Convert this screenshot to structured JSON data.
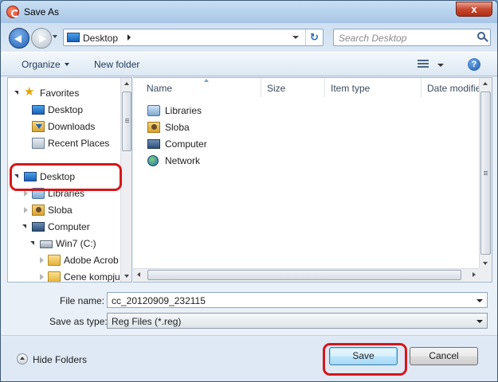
{
  "window": {
    "title": "Save As",
    "close_label": "x"
  },
  "navbar": {
    "address": "Desktop",
    "search_placeholder": "Search Desktop",
    "refresh_label": "↻"
  },
  "toolbar": {
    "organize_label": "Organize",
    "new_folder_label": "New folder",
    "help_label": "?"
  },
  "navpane": {
    "items": [
      {
        "label": "Favorites"
      },
      {
        "label": "Desktop"
      },
      {
        "label": "Downloads"
      },
      {
        "label": "Recent Places"
      },
      {
        "label": "Desktop"
      },
      {
        "label": "Libraries"
      },
      {
        "label": "Sloba"
      },
      {
        "label": "Computer"
      },
      {
        "label": "Win7 (C:)"
      },
      {
        "label": "Adobe Acrob"
      },
      {
        "label": "Cene kompju"
      }
    ]
  },
  "filepane": {
    "columns": [
      "Name",
      "Size",
      "Item type",
      "Date modifie"
    ],
    "items": [
      {
        "label": "Libraries",
        "icon": "libraries-icon"
      },
      {
        "label": "Sloba",
        "icon": "user-folder-icon"
      },
      {
        "label": "Computer",
        "icon": "computer-icon"
      },
      {
        "label": "Network",
        "icon": "network-icon"
      }
    ]
  },
  "form": {
    "file_name_label": "File name:",
    "file_name_value": "cc_20120909_232115",
    "save_type_label": "Save as type:",
    "save_type_value": "Reg Files (*.reg)"
  },
  "footer": {
    "hide_folders_label": "Hide Folders",
    "save_label": "Save",
    "cancel_label": "Cancel"
  },
  "colors": {
    "highlight_ring": "#d6161a",
    "accent": "#1f5fb6"
  }
}
